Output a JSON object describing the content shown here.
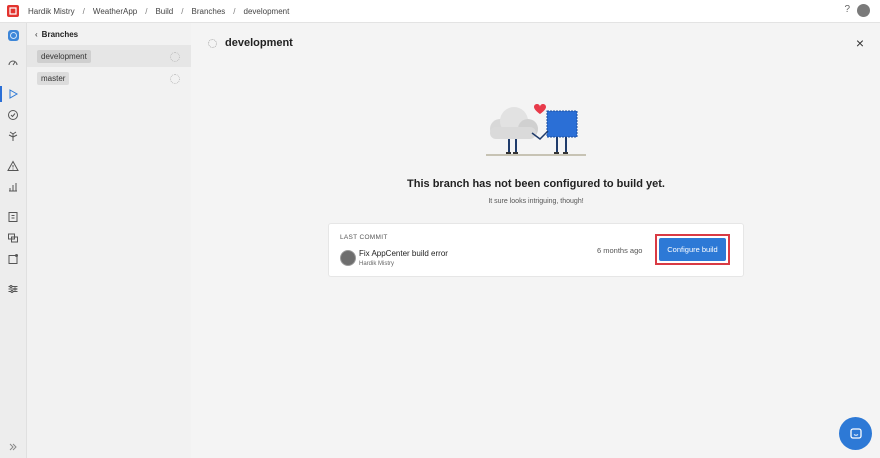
{
  "breadcrumb": [
    "Hardik Mistry",
    "WeatherApp",
    "Build",
    "Branches",
    "development"
  ],
  "header": {
    "help_label": "?"
  },
  "branches_panel": {
    "back_label": "Branches",
    "items": [
      {
        "name": "development",
        "active": true
      },
      {
        "name": "master",
        "active": false
      }
    ]
  },
  "main": {
    "title": "development",
    "close_label": "×",
    "empty_title": "This branch has not been configured to build yet.",
    "empty_subtitle": "It sure looks intriguing, though!",
    "commit": {
      "section_label": "LAST COMMIT",
      "message": "Fix AppCenter build error",
      "author": "Hardik Mistry",
      "time": "6 months ago",
      "action_label": "Configure build"
    }
  },
  "rail_icons": [
    "app-icon",
    "overview-icon",
    "build-icon",
    "test-icon",
    "distribute-icon",
    "diagnostics-icon",
    "analytics-icon",
    "auth-icon",
    "data-icon",
    "push-icon",
    "settings-icon"
  ],
  "colors": {
    "accent": "#2d79d6",
    "highlight": "#d93a44",
    "brand": "#e3342f",
    "heart": "#e83a4a"
  }
}
